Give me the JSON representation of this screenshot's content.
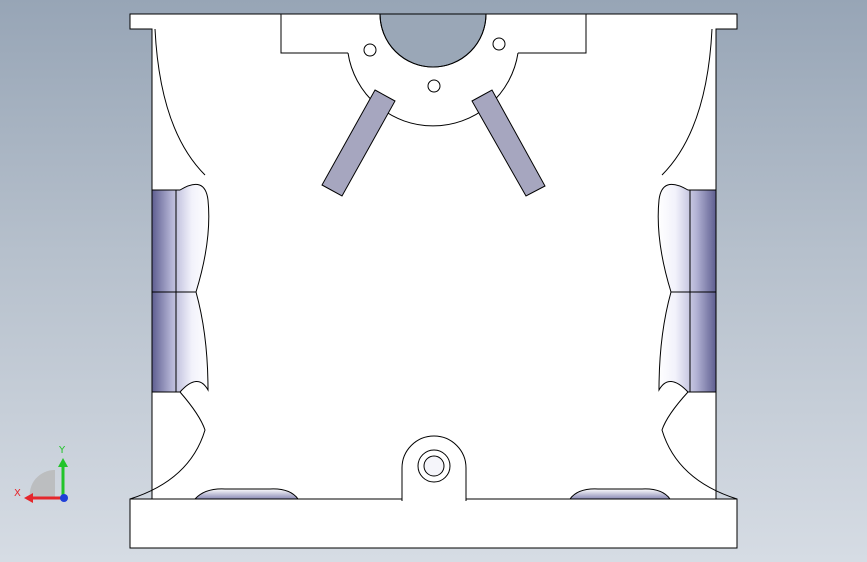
{
  "viewport": {
    "name": "front-view",
    "background_top": "#97a5b6",
    "background_bottom": "#d6dce4"
  },
  "part": {
    "face_color": "#ffffff",
    "edge_color": "#000000",
    "slot_color": "#a6a6bf",
    "shade_color": "#7f7fa6"
  },
  "triad": {
    "x_label": "X",
    "y_label": "Y",
    "x_color": "#e5262b",
    "y_color": "#22c42a",
    "z_color": "#1f3fd8"
  }
}
